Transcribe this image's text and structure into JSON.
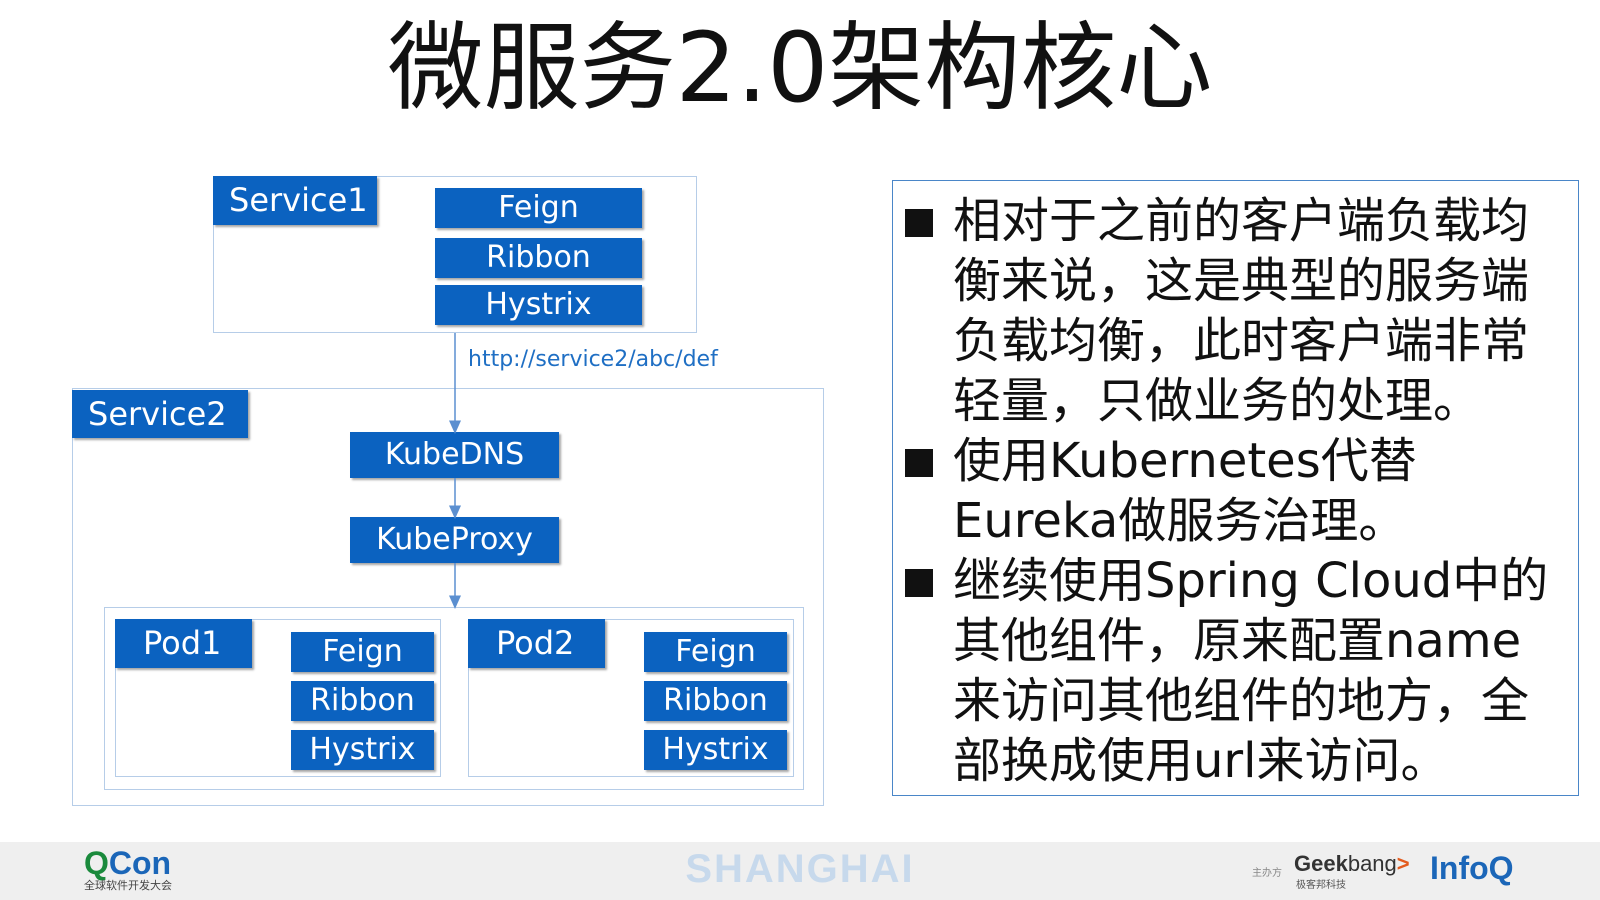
{
  "title": "微服务2.0架构核心",
  "diagram": {
    "service1": {
      "label": "Service1",
      "components": [
        "Feign",
        "Ribbon",
        "Hystrix"
      ]
    },
    "url": "http://service2/abc/def",
    "service2": {
      "label": "Service2",
      "kubedns": "KubeDNS",
      "kubeproxy": "KubeProxy",
      "pod1": {
        "label": "Pod1",
        "components": [
          "Feign",
          "Ribbon",
          "Hystrix"
        ]
      },
      "pod2": {
        "label": "Pod2",
        "components": [
          "Feign",
          "Ribbon",
          "Hystrix"
        ]
      }
    }
  },
  "bullets": [
    "相对于之前的客户端负载均衡来说，这是典型的服务端负载均衡，此时客户端非常轻量，只做业务的处理。",
    "使用Kubernetes代替Eureka做服务治理。",
    "继续使用Spring Cloud中的其他组件，原来配置name来访问其他组件的地方，全部换成使用url来访问。"
  ],
  "footer": {
    "qcon_q": "Q",
    "qcon_con": "Con",
    "qcon_sub": "全球软件开发大会",
    "city": "SHANGHAI",
    "sponsor_label": "主办方",
    "geek": "Geek",
    "bang": "bang",
    "geek_gt": ">",
    "geek_sub": "极客邦科技",
    "infoq": "InfoQ"
  },
  "colors": {
    "box_fill": "#0b62c0",
    "frame_border": "#b6cde8",
    "panel_border": "#4a86c8",
    "url_text": "#1f6fc4"
  }
}
